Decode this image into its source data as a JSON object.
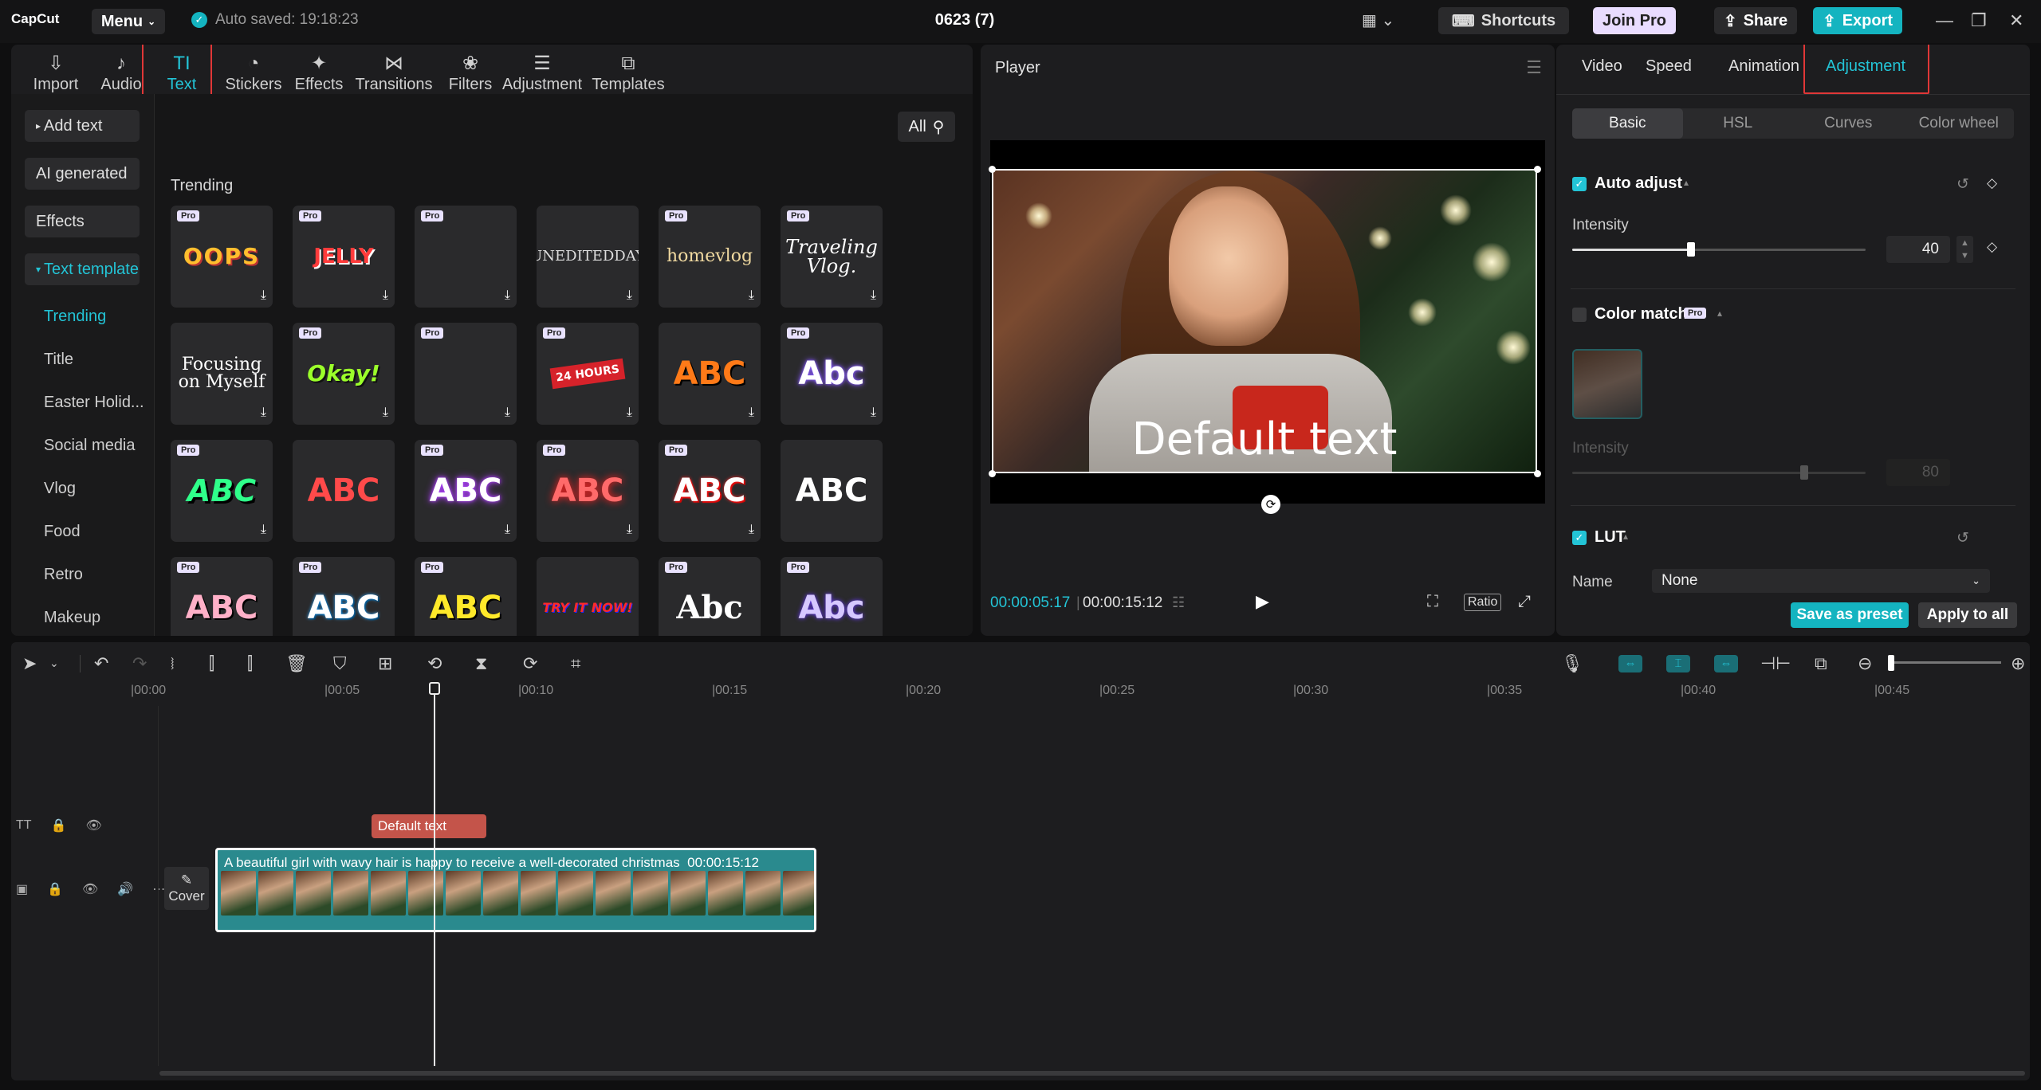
{
  "titlebar": {
    "logo": "CapCut",
    "menu_label": "Menu",
    "autosaved": "Auto saved: 19:18:23",
    "project_title": "0623 (7)",
    "shortcuts": "Shortcuts",
    "join_pro": "Join Pro",
    "share": "Share",
    "export": "Export"
  },
  "toolbar": {
    "tabs": [
      {
        "label": "Import",
        "icon": "import-icon"
      },
      {
        "label": "Audio",
        "icon": "audio-icon"
      },
      {
        "label": "Text",
        "icon": "text-icon"
      },
      {
        "label": "Stickers",
        "icon": "stickers-icon"
      },
      {
        "label": "Effects",
        "icon": "effects-icon"
      },
      {
        "label": "Transitions",
        "icon": "transitions-icon"
      },
      {
        "label": "Filters",
        "icon": "filters-icon"
      },
      {
        "label": "Adjustment",
        "icon": "adjustment-icon"
      },
      {
        "label": "Templates",
        "icon": "templates-icon"
      }
    ],
    "active_tab": "Text"
  },
  "sidebar": {
    "buttons": [
      "Add text",
      "AI generated",
      "Effects",
      "Text template"
    ],
    "items": [
      "Trending",
      "Title",
      "Easter Holid...",
      "Social media",
      "Vlog",
      "Food",
      "Retro",
      "Makeup"
    ]
  },
  "library": {
    "filter_label": "All",
    "section": "Trending",
    "pro_badge": "Pro",
    "tiles": [
      {
        "text": "OOPS"
      },
      {
        "text": "JELLY"
      },
      {
        "text": ""
      },
      {
        "text": "UNEDITEDDAY"
      },
      {
        "text": "homevlog"
      },
      {
        "text": "Traveling Vlog."
      },
      {
        "text": "Focusing on Myself"
      },
      {
        "text": "Okay!"
      },
      {
        "text": ""
      },
      {
        "text": "24 HOURS"
      },
      {
        "text": "ABC"
      },
      {
        "text": "Abc"
      },
      {
        "text": "ABC"
      },
      {
        "text": "ABC"
      },
      {
        "text": "ABC"
      },
      {
        "text": "ABC"
      },
      {
        "text": "ABC"
      },
      {
        "text": "ABC"
      },
      {
        "text": "ABC"
      },
      {
        "text": "ABC"
      },
      {
        "text": "ABC"
      },
      {
        "text": "TRY IT NOW!"
      },
      {
        "text": "Abc"
      },
      {
        "text": "Abc"
      }
    ]
  },
  "player": {
    "title": "Player",
    "overlay_text": "Default text",
    "current_time": "00:00:05:17",
    "duration": "00:00:15:12",
    "ratio_label": "Ratio"
  },
  "inspector": {
    "tabs": [
      "Video",
      "Speed",
      "Animation",
      "Adjustment"
    ],
    "active_tab": "Adjustment",
    "subtabs": [
      "Basic",
      "HSL",
      "Curves",
      "Color wheel"
    ],
    "auto_adjust": {
      "label": "Auto adjust",
      "intensity_label": "Intensity",
      "intensity_value": "40",
      "checked": true
    },
    "color_match": {
      "label": "Color match",
      "pro": "Pro",
      "intensity_label": "Intensity",
      "intensity_value": "80",
      "checked": false
    },
    "lut": {
      "label": "LUT",
      "name_label": "Name",
      "name_value": "None",
      "checked": true
    },
    "save_preset": "Save as preset",
    "apply_all": "Apply to all"
  },
  "timeline": {
    "ticks": [
      "|00:00",
      "|00:05",
      "|00:10",
      "|00:15",
      "|00:20",
      "|00:25",
      "|00:30",
      "|00:35",
      "|00:40",
      "|00:45"
    ],
    "text_clip_label": "Default text",
    "video_clip_caption": "A beautiful girl with wavy hair is happy to receive a well-decorated christmas",
    "video_clip_duration": "00:00:15:12",
    "cover_label": "Cover"
  },
  "colors": {
    "accent": "#23c4d6",
    "highlight_box": "#e03737",
    "clip_text": "#c4544a",
    "clip_video": "#2a8a8e"
  }
}
